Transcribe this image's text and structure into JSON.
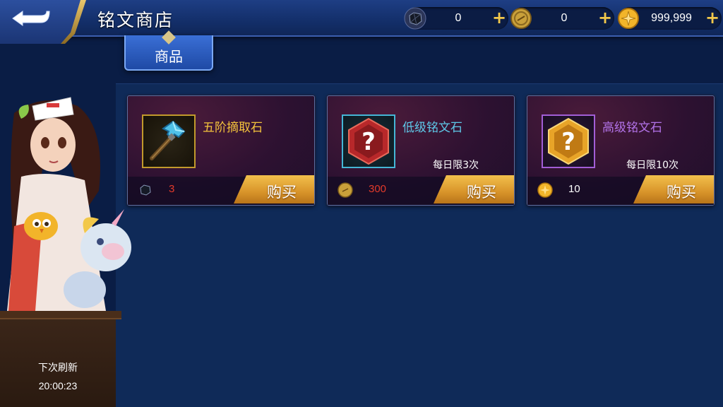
{
  "header": {
    "title": "铭文商店",
    "currencies": [
      {
        "icon": "stone-currency-icon",
        "value": "0"
      },
      {
        "icon": "coupon-coin-icon",
        "value": "0"
      },
      {
        "icon": "gold-coin-icon",
        "value": "999,999"
      }
    ],
    "plus_label": "+"
  },
  "tabs": [
    {
      "label": "商品",
      "active": true
    }
  ],
  "items": [
    {
      "name": "五阶摘取石",
      "name_color": "#f4c33c",
      "icon": "hammer-icon",
      "limit": "",
      "price": "3",
      "price_color": "#e33a2a",
      "currency_icon": "stone-currency-icon",
      "buy_label": "购买"
    },
    {
      "name": "低级铭文石",
      "name_color": "#5ec8e8",
      "icon": "red-mystery-hexagon-icon",
      "limit": "每日限3次",
      "price": "300",
      "price_color": "#e33a2a",
      "currency_icon": "coupon-coin-icon",
      "buy_label": "购买"
    },
    {
      "name": "高级铭文石",
      "name_color": "#b272e8",
      "icon": "gold-mystery-hexagon-icon",
      "limit": "每日限10次",
      "price": "10",
      "price_color": "#ffffff",
      "currency_icon": "gold-coin-icon",
      "buy_label": "购买"
    }
  ],
  "refresh": {
    "label": "下次刷新",
    "time": "20:00:23"
  },
  "colors": {
    "background": "#0a1d45",
    "header": "#1e3e84",
    "gold_accent": "#f2c04c"
  }
}
